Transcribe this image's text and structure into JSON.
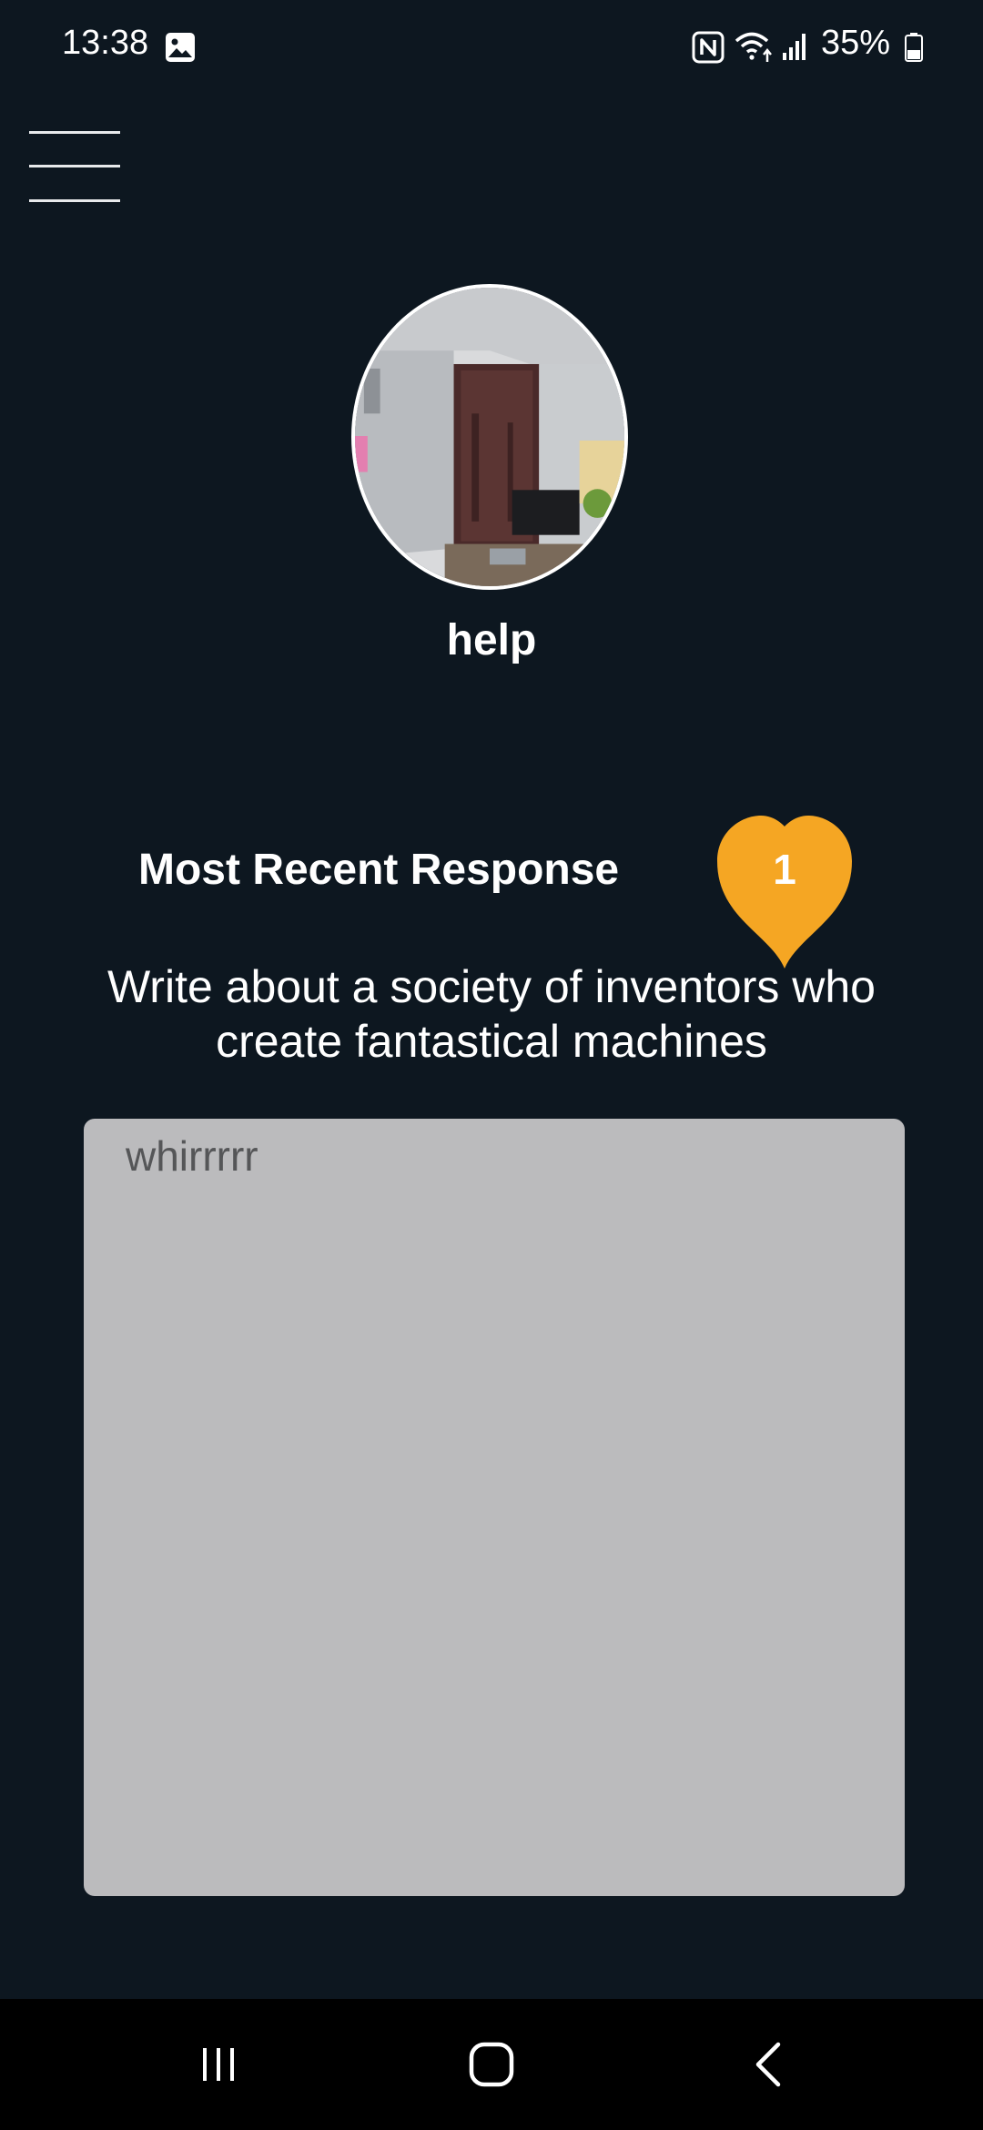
{
  "status_bar": {
    "time": "13:38",
    "battery_percent": "35%",
    "icons": [
      "gallery-icon",
      "nfc-icon",
      "wifi-icon",
      "signal-icon",
      "battery-icon"
    ]
  },
  "menu": {
    "icon": "hamburger-menu-icon"
  },
  "profile": {
    "name": "help",
    "avatar": "profile-photo"
  },
  "recent": {
    "heading": "Most Recent Response",
    "likes": "1",
    "prompt": "Write about a society of inventors who create fantastical machines",
    "response": "whirrrrr"
  },
  "colors": {
    "background": "#0d1720",
    "heart": "#f5a623",
    "response_box": "#bbbbbd",
    "response_text": "#555658"
  },
  "nav_bar": {
    "items": [
      "recent-apps-icon",
      "home-icon",
      "back-icon"
    ]
  }
}
